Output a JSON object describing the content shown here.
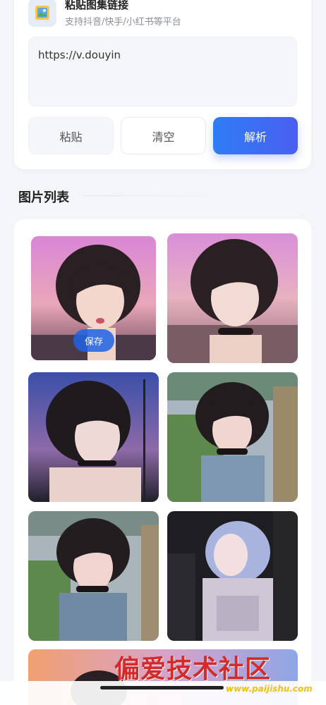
{
  "header": {
    "title": "粘贴图集链接",
    "subtitle": "支持抖音/快手/小红书等平台"
  },
  "input": {
    "value": "https://v.douyin"
  },
  "buttons": {
    "paste": "粘贴",
    "clear": "清空",
    "parse": "解析"
  },
  "section": {
    "title": "图片列表"
  },
  "gallery": {
    "save_label": "保存",
    "images": [
      {
        "name": "photo-1",
        "tone": "pink-sky"
      },
      {
        "name": "photo-2",
        "tone": "pink-sky"
      },
      {
        "name": "photo-3",
        "tone": "night-street"
      },
      {
        "name": "photo-4",
        "tone": "street-day"
      },
      {
        "name": "photo-5",
        "tone": "street-day"
      },
      {
        "name": "photo-6",
        "tone": "dark-lavender"
      },
      {
        "name": "photo-7",
        "tone": "sunset"
      }
    ]
  },
  "watermark": {
    "title": "偏爱技术社区",
    "url": "www.paijishu.com"
  },
  "colors": {
    "accent": "#2f7cf6",
    "accent_end": "#4a5ff0",
    "watermark_red": "#d42a2a",
    "watermark_yellow": "#f0c010"
  }
}
